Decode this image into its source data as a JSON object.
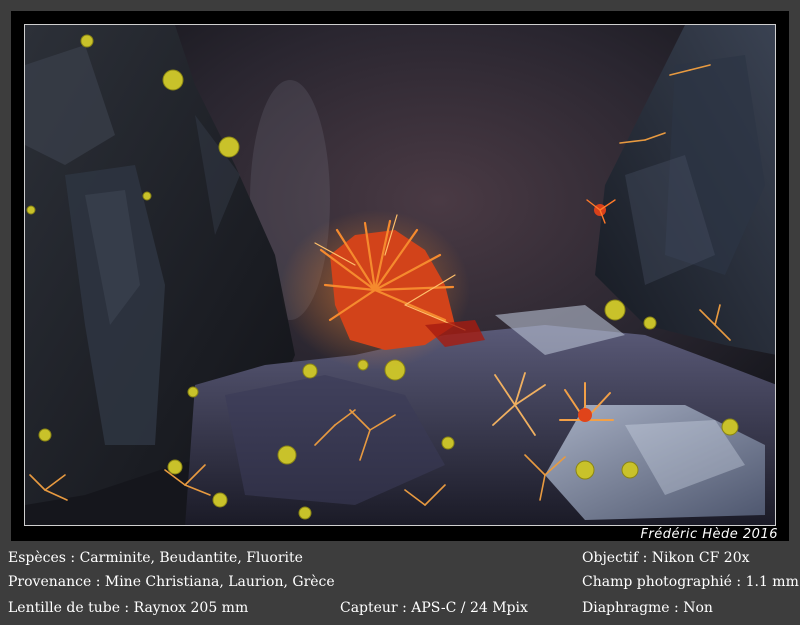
{
  "signature": "Frédéric Hède 2016",
  "caption": {
    "species": "Espèces : Carminite, Beudantite, Fluorite",
    "provenance": "Provenance : Mine Christiana, Laurion, Grèce",
    "tube_lens": "Lentille de tube : Raynox 205 mm",
    "sensor": "Capteur : APS-C / 24 Mpix",
    "objective": "Objectif : Nikon CF 20x",
    "field": "Champ photographié : 1.1 mm",
    "diaphragm": "Diaphragme : Non"
  },
  "colors": {
    "background": "#3d3d3d",
    "frame": "#000000",
    "text": "#ffffff",
    "carminite": "#e8621c",
    "beudantite": "#c9c22a"
  }
}
